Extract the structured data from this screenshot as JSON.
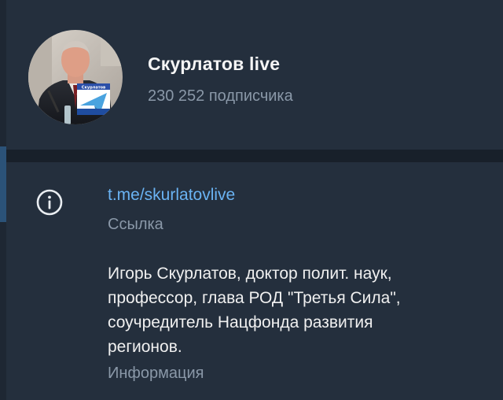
{
  "channel": {
    "title": "Скурлатов live",
    "subscribers": "230 252 подписчика",
    "avatar_logo_text": "Скурлатов"
  },
  "info": {
    "icon": "info-icon",
    "link": "t.me/skurlatovlive",
    "link_caption": "Ссылка",
    "description_lines": [
      "Игорь Скурлатов, доктор полит. наук,",
      "профессор, глава РОД \"Третья Сила\",",
      "соучредитель Нацфонда развития",
      "регионов."
    ],
    "description_caption": "Информация"
  },
  "colors": {
    "panel_bg": "#242f3d",
    "divider": "#18202a",
    "link": "#6ab3f3",
    "secondary_text": "#8a98a8",
    "primary_text": "#f0f0f0"
  }
}
